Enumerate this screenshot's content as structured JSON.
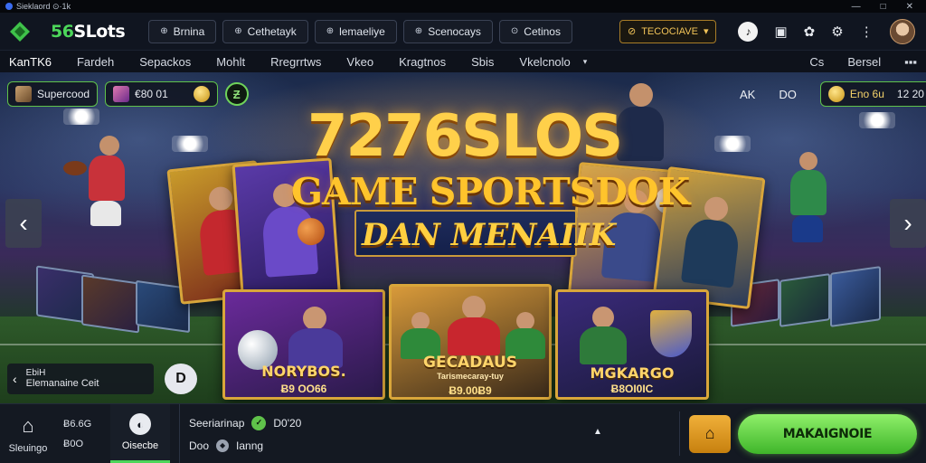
{
  "window": {
    "title": "Sieklaord  ⊙·1k",
    "controls": [
      "—",
      "□",
      "✕"
    ]
  },
  "header": {
    "logo": "56SLots",
    "nav": [
      {
        "icon": "⊕",
        "label": "Brnina"
      },
      {
        "icon": "⊕",
        "label": "Cethetayk"
      },
      {
        "icon": "⊕",
        "label": "lemaeliye"
      },
      {
        "icon": "⊕",
        "label": "Scenocays"
      },
      {
        "icon": "⊙",
        "label": "Cetinos"
      }
    ],
    "language": "TECOCIAVE",
    "language_icon": "⊘",
    "language_arrow": "▾",
    "icon_glyphs": {
      "music": "♪",
      "chat": "▣",
      "gift": "✿",
      "settings": "⚙",
      "more": "⋮"
    }
  },
  "categories": {
    "items": [
      "KanTK6",
      "Fardeh",
      "Sepackos",
      "Mohlt",
      "Rregrrtws",
      "Vkeo",
      "Kragtnos",
      "Sbis",
      "Vkelcnolo"
    ],
    "more": "▾",
    "right": [
      "Cs",
      "Bersel",
      "▪▪▪"
    ]
  },
  "hero": {
    "user_chip": "Supercood",
    "balance_chip": "€80 01",
    "green_button": "Ƶ",
    "top_right": [
      "AK",
      "DO"
    ],
    "coin_chip": "Eno 6u",
    "coin_chip_value": "12 20",
    "title": "7276SLOS",
    "subtitle": "GAME SPORTSDOK",
    "subtitle2": "DAN MENAIIK",
    "arrow_left": "‹",
    "arrow_right": "›",
    "cards": [
      {
        "label": "NORYBOS.",
        "value": "Ƀ9 OO66"
      },
      {
        "label": "GECADAUS",
        "sub": "Tarismecaray-tuy",
        "value": "Ƀ9.00Ƀ9"
      },
      {
        "label": "MGKARGO",
        "value": "Ƀ8OI0IC"
      }
    ],
    "live": {
      "line1": "EbiH",
      "line2": "Elemanaine Ceit",
      "back": "‹"
    },
    "d_button": "D"
  },
  "bottom": {
    "home_label": "Sleuingo",
    "home_icon": "⌂",
    "stats": [
      "Ƀ6.6G",
      "Ƀ0O"
    ],
    "active_label": "Oisecbe",
    "active_icon": "◐",
    "info": [
      {
        "label": "Seeriarinap",
        "value": "D0'20"
      },
      {
        "label": "Doo",
        "value": "Ianng"
      }
    ],
    "user_icon": "⌂",
    "cta": "MAKAIGNOIE"
  },
  "colors": {
    "accent_green": "#4cd65a",
    "gold": "#ffd04a",
    "header_bg": "#101520"
  }
}
